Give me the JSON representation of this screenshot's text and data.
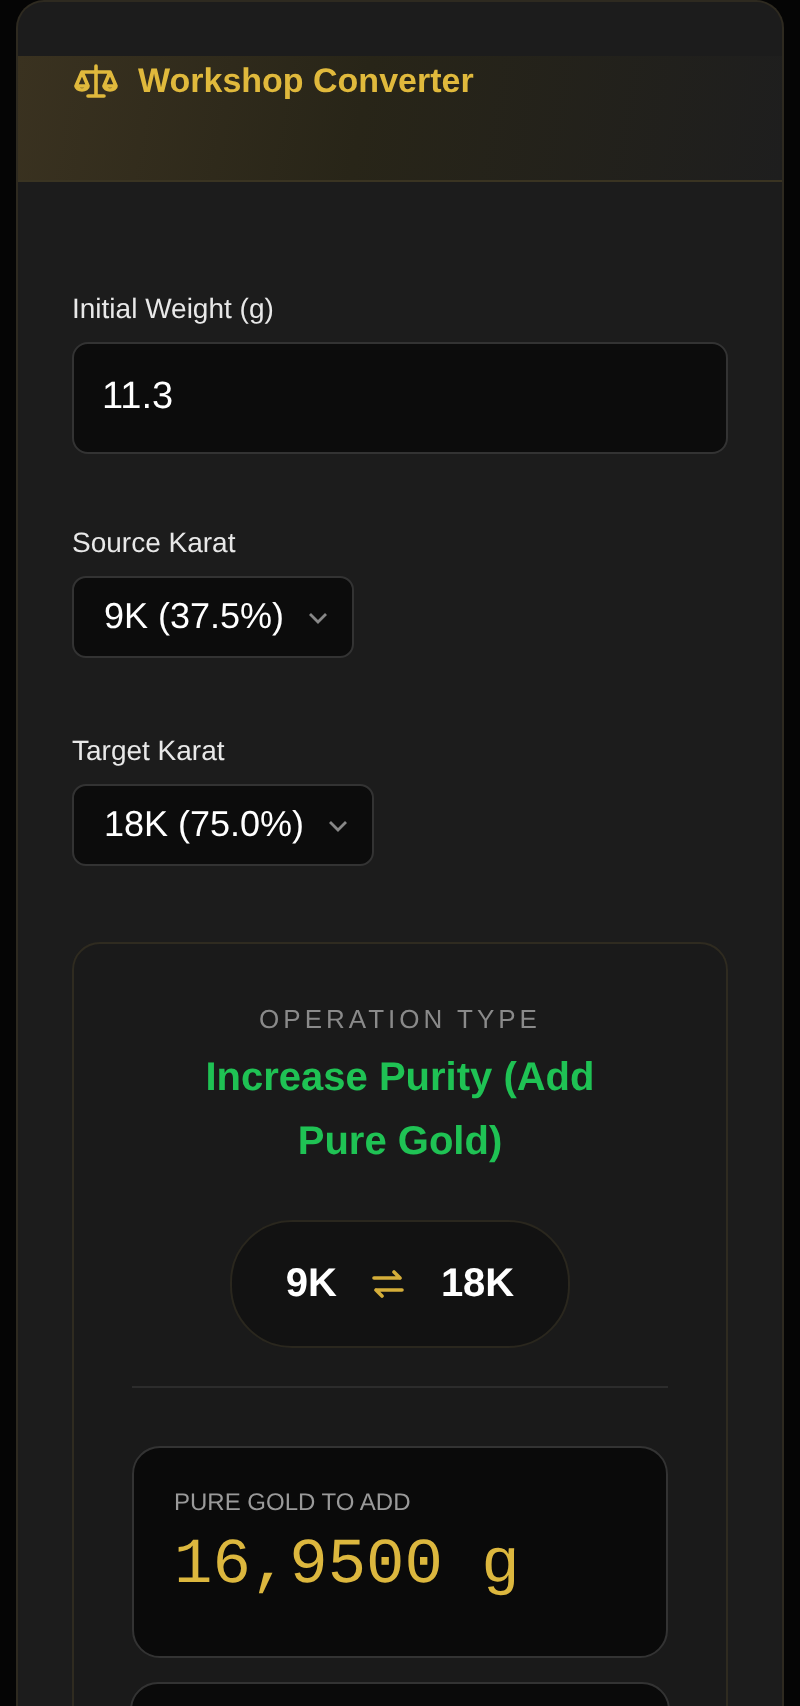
{
  "header": {
    "title": "Workshop Converter"
  },
  "fields": [
    {
      "kind": "input",
      "label": "Initial Weight (g)",
      "value": "11.3"
    },
    {
      "kind": "select",
      "label": "Source Karat",
      "value": "9K (37.5%)"
    },
    {
      "kind": "select",
      "label": "Target Karat",
      "value": "18K (75.0%)"
    }
  ],
  "operation": {
    "caption": "OPERATION TYPE",
    "title": "Increase Purity (Add Pure Gold)",
    "from": "9K",
    "to": "18K"
  },
  "result": {
    "label": "PURE GOLD TO ADD",
    "value": "16,9500 g"
  }
}
